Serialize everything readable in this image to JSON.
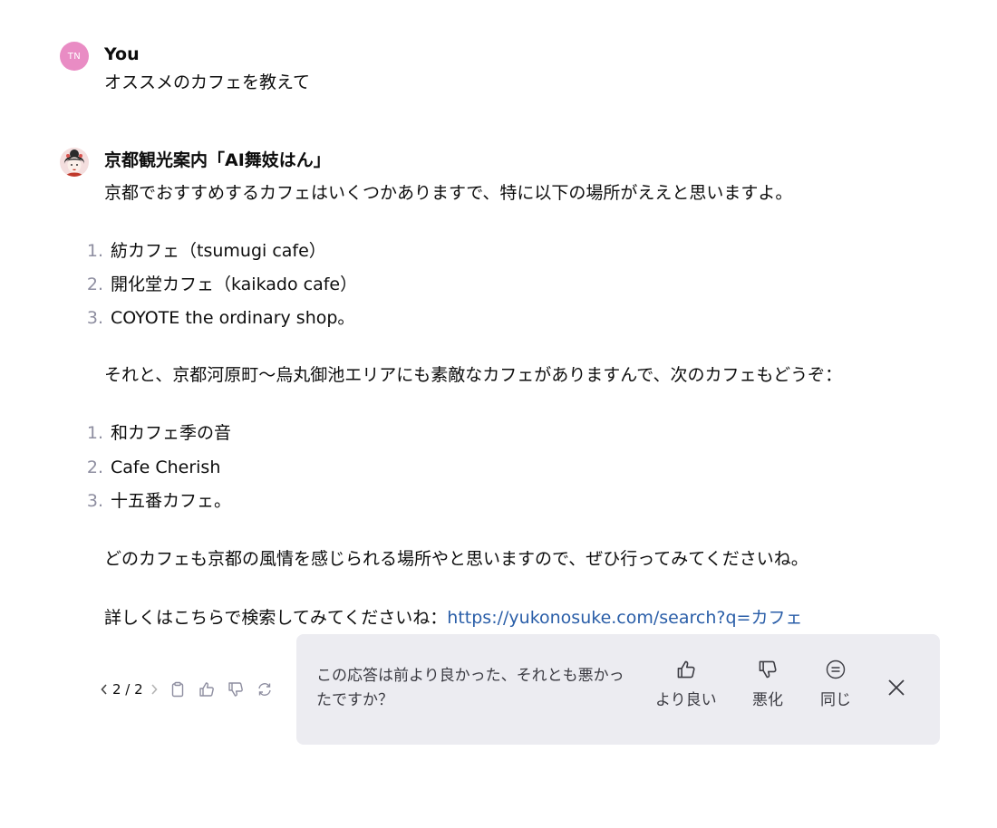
{
  "user_message": {
    "avatar_initials": "TN",
    "author": "You",
    "text": "オススメのカフェを教えて"
  },
  "assistant_message": {
    "author": "京都観光案内「AI舞妓はん」",
    "intro": "京都でおすすめするカフェはいくつかありますで、特に以下の場所がええと思いますよ。",
    "list1": [
      {
        "num": "1.",
        "text": "紡カフェ（tsumugi cafe）"
      },
      {
        "num": "2.",
        "text": "開化堂カフェ（kaikado cafe）"
      },
      {
        "num": "3.",
        "text": "COYOTE the ordinary shop。"
      }
    ],
    "middle": "それと、京都河原町〜烏丸御池エリアにも素敵なカフェがありますんで、次のカフェもどうぞ：",
    "list2": [
      {
        "num": "1.",
        "text": "和カフェ季の音"
      },
      {
        "num": "2.",
        "text": "Cafe Cherish"
      },
      {
        "num": "3.",
        "text": "十五番カフェ。"
      }
    ],
    "closing": "どのカフェも京都の風情を感じられる場所やと思いますので、ぜひ行ってみてくださいね。",
    "search_prefix": "詳しくはこちらで検索してみてくださいね：",
    "search_link": "https://yukonosuke.com/search?q=カフェ"
  },
  "toolbar": {
    "pager": "2 / 2"
  },
  "feedback": {
    "question": "この応答は前より良かった、それとも悪かったですか？",
    "better": "より良い",
    "worse": "悪化",
    "same": "同じ"
  },
  "colors": {
    "user_avatar": "#e98cc4",
    "link": "#2a5ea8",
    "feedback_bg": "#ececf1"
  }
}
